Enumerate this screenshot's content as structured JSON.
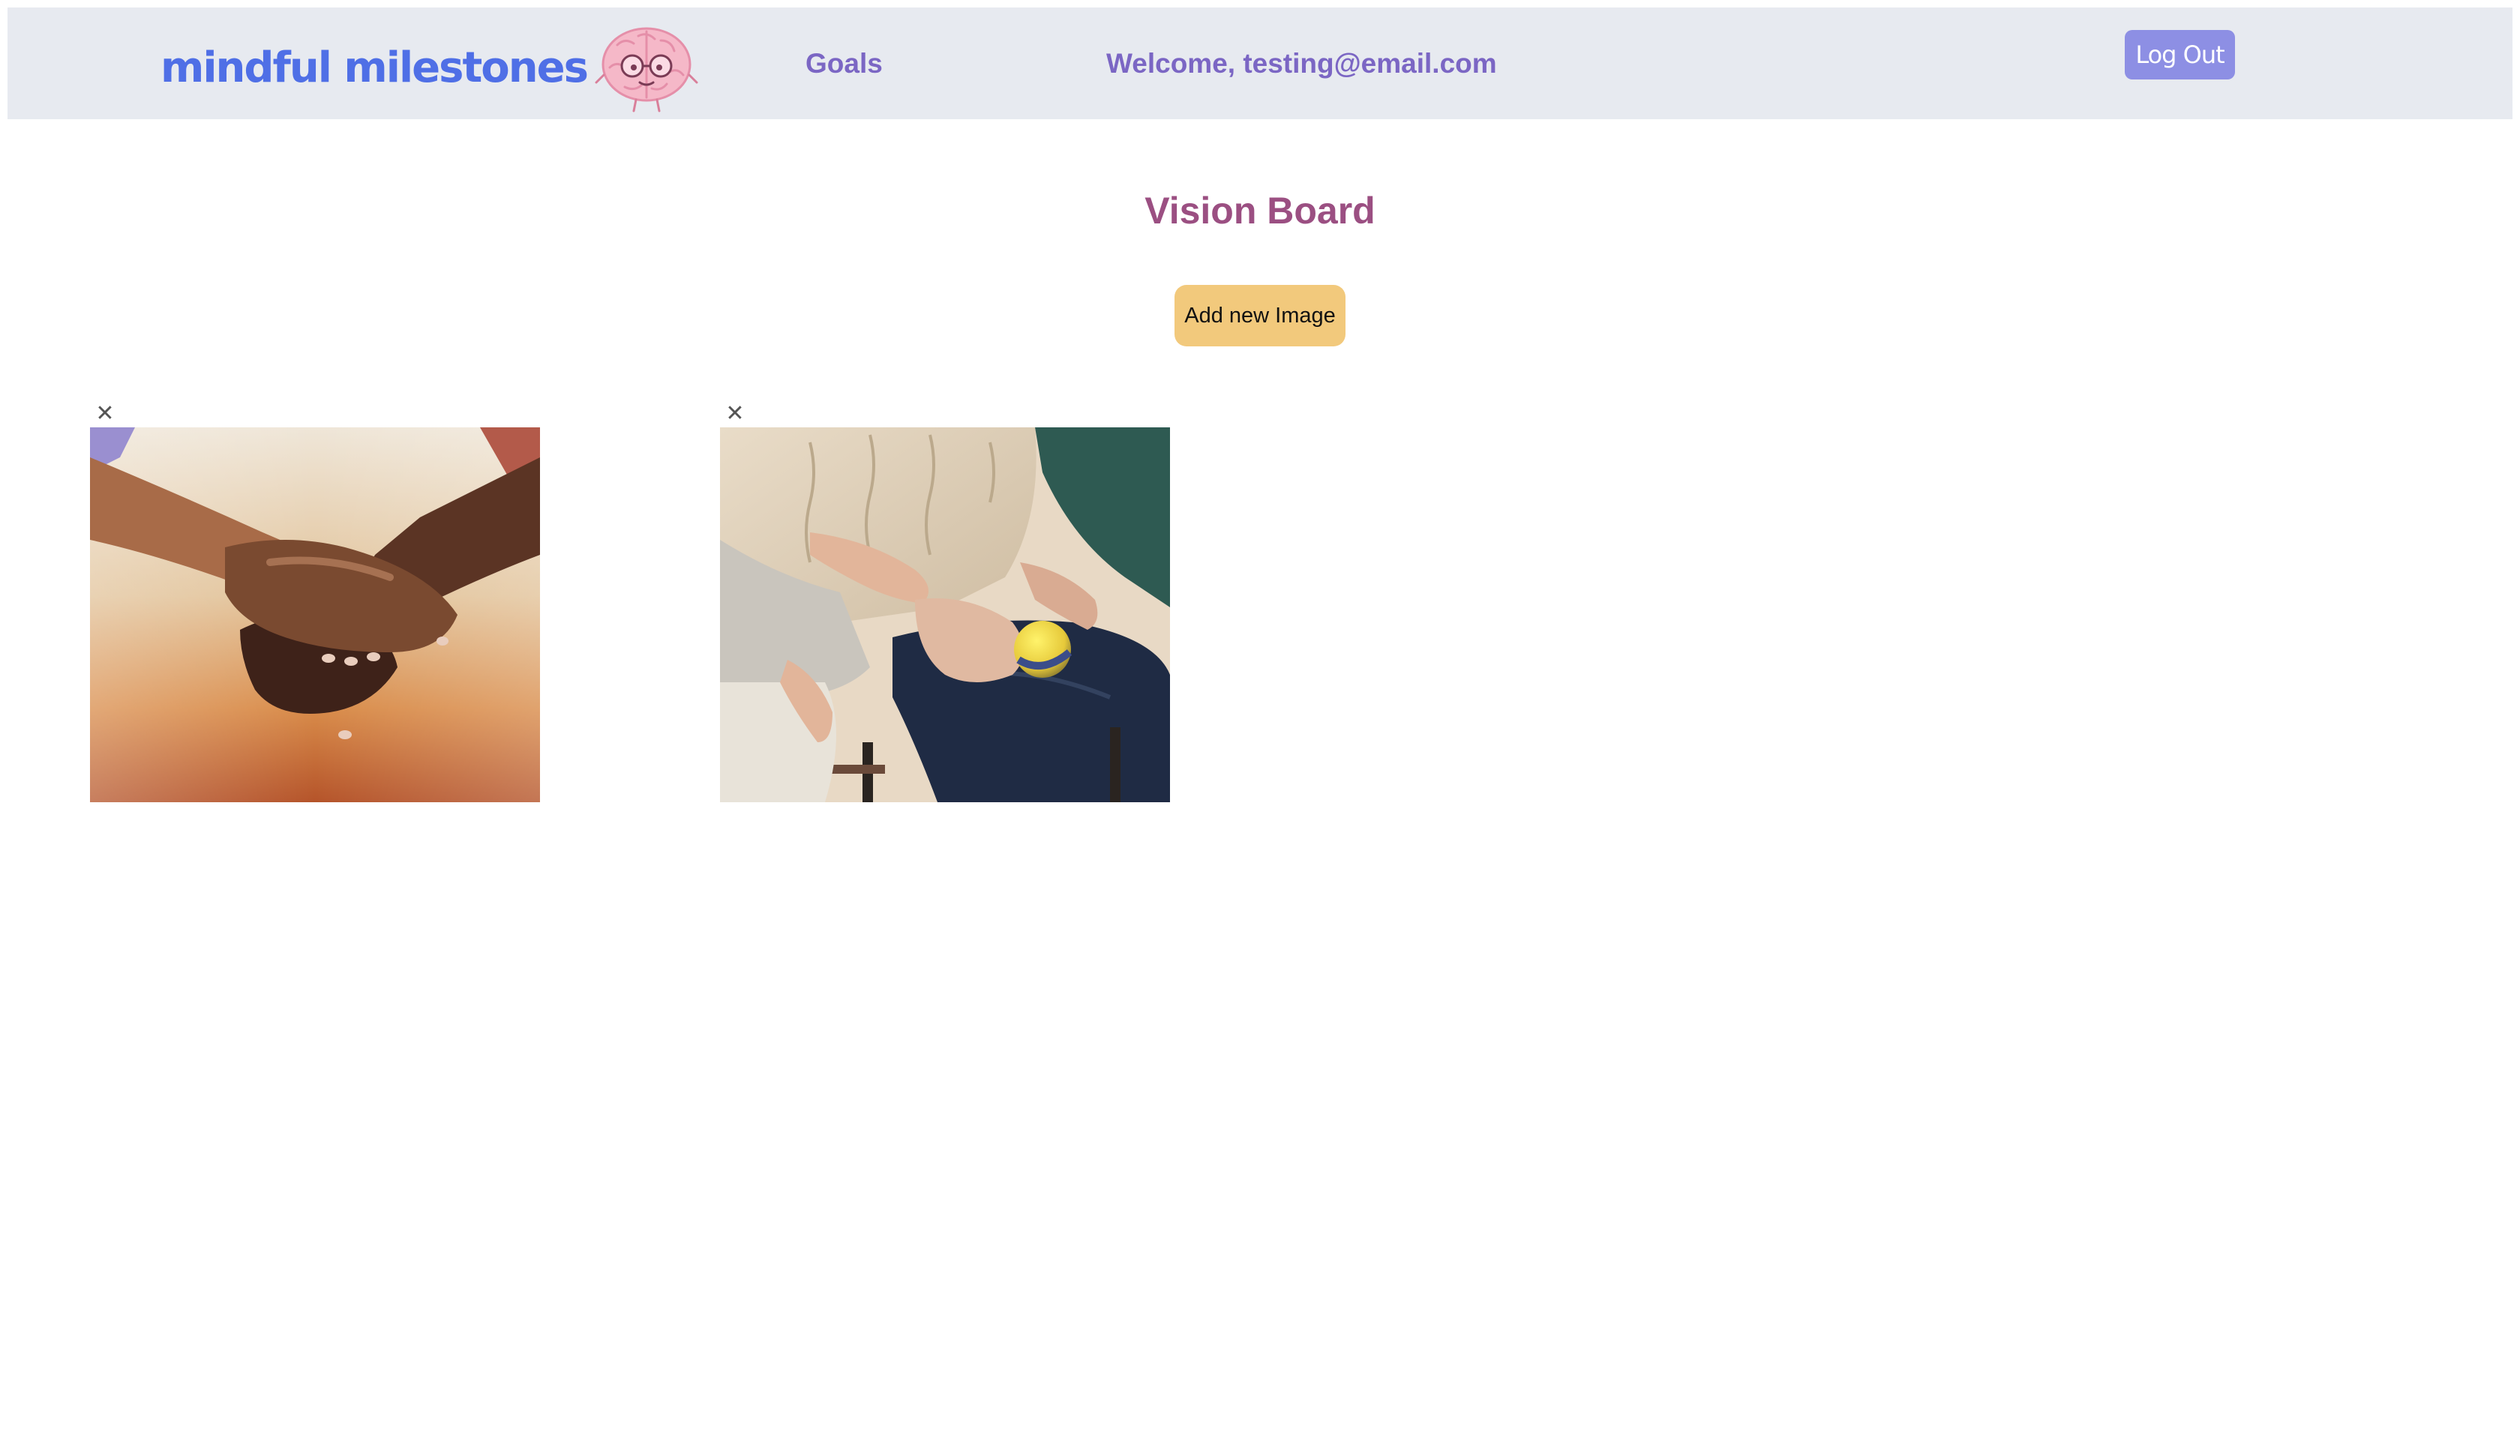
{
  "navbar": {
    "logo_text": "mindful milestones",
    "goals_label": "Goals",
    "welcome_text": "Welcome, testing@email.com",
    "logout_label": "Log Out"
  },
  "main": {
    "title": "Vision Board",
    "add_image_label": "Add new Image",
    "remove_glyph": "✕",
    "images": [
      {
        "description": "holding-hands photo"
      },
      {
        "description": "elderly person holding stress ball photo"
      }
    ]
  },
  "colors": {
    "navbar_bg": "#e7eaf0",
    "logo": "#4f6fe6",
    "nav_link": "#7b66c4",
    "title": "#9b4f82",
    "add_button": "#f2c97c",
    "logout_button": "#8d8fe4"
  },
  "icons": {
    "logo_mascot": "brain-with-glasses-icon",
    "remove": "close-icon"
  }
}
